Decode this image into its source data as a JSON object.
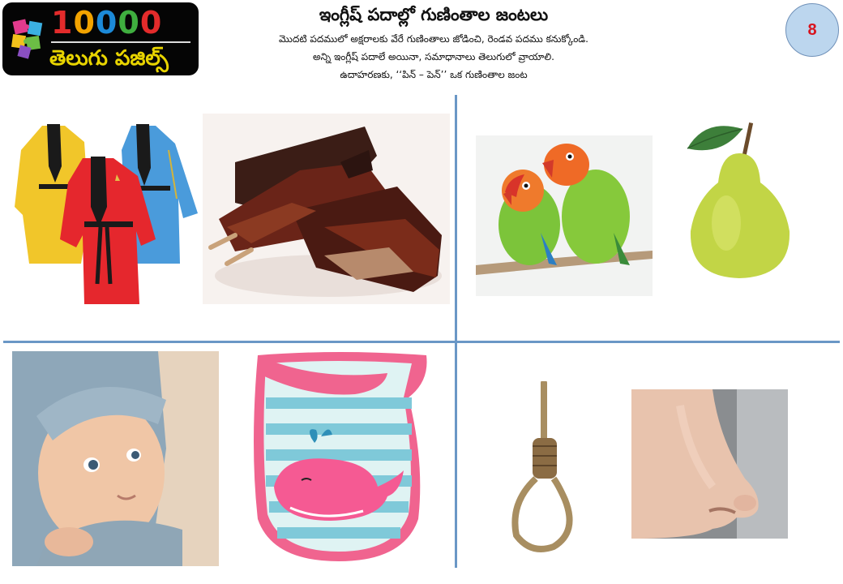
{
  "logo": {
    "digits": [
      "1",
      "0",
      "0",
      "0",
      "0"
    ],
    "digit_colors": [
      "#e32b2b",
      "#f2a300",
      "#1c8ad8",
      "#3fae3f",
      "#e32b2b"
    ],
    "subtitle": "తెలుగు పజిల్స్"
  },
  "header": {
    "title": "ఇంగ్లీష్ పదాల్లో గుణింతాల జంటలు",
    "instructions": [
      "మొదటి పదములో అక్షరాలకు వేరే గుణింతాలు జోడించి, రెండవ పదము కనుక్కోండి.",
      "అన్ని ఇంగ్లీష్ పదాలే అయినా, సమాధానాలు తెలుగులో వ్రాయాలి.",
      "ఉదాహరణకు, ‘‘పిన్ – పెన్’’ ఒక గుణింతాల జంట"
    ],
    "page_number": "8"
  },
  "colors": {
    "grid_line": "#6a97c6",
    "badge_fill": "#bcd6ee",
    "badge_text": "#d8141e"
  },
  "pictures": [
    {
      "name": "robes-picture",
      "subject": "bathrobes"
    },
    {
      "name": "ribs-picture",
      "subject": "barbecue ribs"
    },
    {
      "name": "parrots-picture",
      "subject": "lovebirds on branch"
    },
    {
      "name": "pear-picture",
      "subject": "pear"
    },
    {
      "name": "baby-picture",
      "subject": "baby in hood"
    },
    {
      "name": "bib-picture",
      "subject": "baby bib with whale"
    },
    {
      "name": "noose-picture",
      "subject": "rope noose"
    },
    {
      "name": "nose-picture",
      "subject": "nose"
    }
  ]
}
